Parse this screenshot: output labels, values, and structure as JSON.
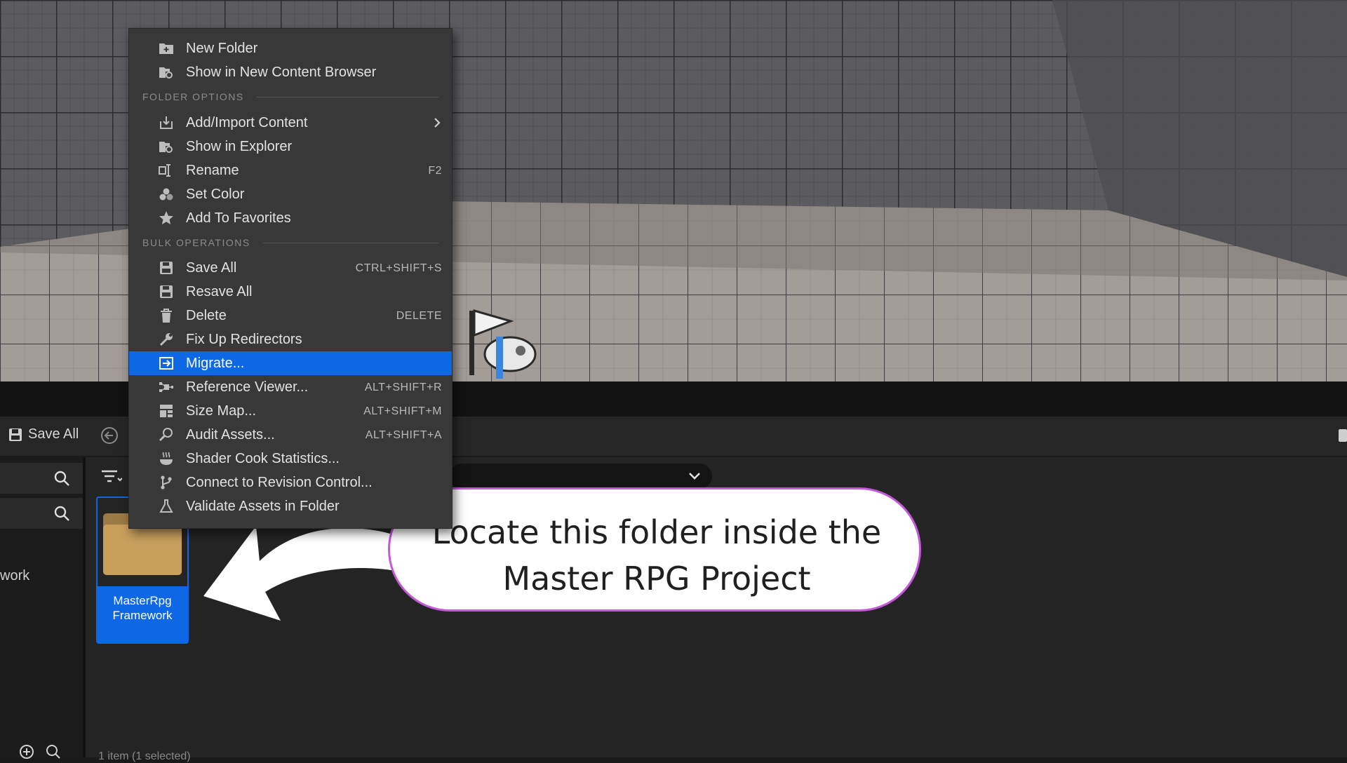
{
  "menu": {
    "items_top": [
      {
        "icon": "new-folder-icon",
        "label": "New Folder",
        "shortcut": ""
      },
      {
        "icon": "show-in-browser-icon",
        "label": "Show in New Content Browser",
        "shortcut": ""
      }
    ],
    "section_folder": "FOLDER OPTIONS",
    "items_folder": [
      {
        "icon": "import-icon",
        "label": "Add/Import Content",
        "shortcut": "",
        "submenu": true
      },
      {
        "icon": "explorer-icon",
        "label": "Show in Explorer",
        "shortcut": ""
      },
      {
        "icon": "rename-icon",
        "label": "Rename",
        "shortcut": "F2"
      },
      {
        "icon": "color-icon",
        "label": "Set Color",
        "shortcut": ""
      },
      {
        "icon": "star-icon",
        "label": "Add To Favorites",
        "shortcut": ""
      }
    ],
    "section_bulk": "BULK OPERATIONS",
    "items_bulk": [
      {
        "icon": "save-icon",
        "label": "Save All",
        "shortcut": "CTRL+SHIFT+S"
      },
      {
        "icon": "resave-icon",
        "label": "Resave All",
        "shortcut": ""
      },
      {
        "icon": "trash-icon",
        "label": "Delete",
        "shortcut": "DELETE"
      },
      {
        "icon": "wrench-icon",
        "label": "Fix Up Redirectors",
        "shortcut": ""
      },
      {
        "icon": "migrate-icon",
        "label": "Migrate...",
        "shortcut": "",
        "active": true
      },
      {
        "icon": "reference-viewer-icon",
        "label": "Reference Viewer...",
        "shortcut": "ALT+SHIFT+R"
      },
      {
        "icon": "size-map-icon",
        "label": "Size Map...",
        "shortcut": "ALT+SHIFT+M"
      },
      {
        "icon": "audit-icon",
        "label": "Audit Assets...",
        "shortcut": "ALT+SHIFT+A"
      },
      {
        "icon": "shader-icon",
        "label": "Shader Cook Statistics...",
        "shortcut": ""
      },
      {
        "icon": "revision-control-icon",
        "label": "Connect to Revision Control...",
        "shortcut": ""
      },
      {
        "icon": "flask-icon",
        "label": "Validate Assets in Folder",
        "shortcut": ""
      }
    ]
  },
  "toolbar": {
    "save_all": "Save All"
  },
  "sidebar": {
    "fragment": "work"
  },
  "folder": {
    "name_line1": "MasterRpg",
    "name_line2": "Framework"
  },
  "status": {
    "fragment": "1 item (1 selected)"
  },
  "callout": {
    "line1": "Locate this folder inside the",
    "line2": "Master RPG Project"
  },
  "colors": {
    "accent": "#0e68e6",
    "callout_border": "#c45ad9",
    "menu_bg": "#383838"
  }
}
